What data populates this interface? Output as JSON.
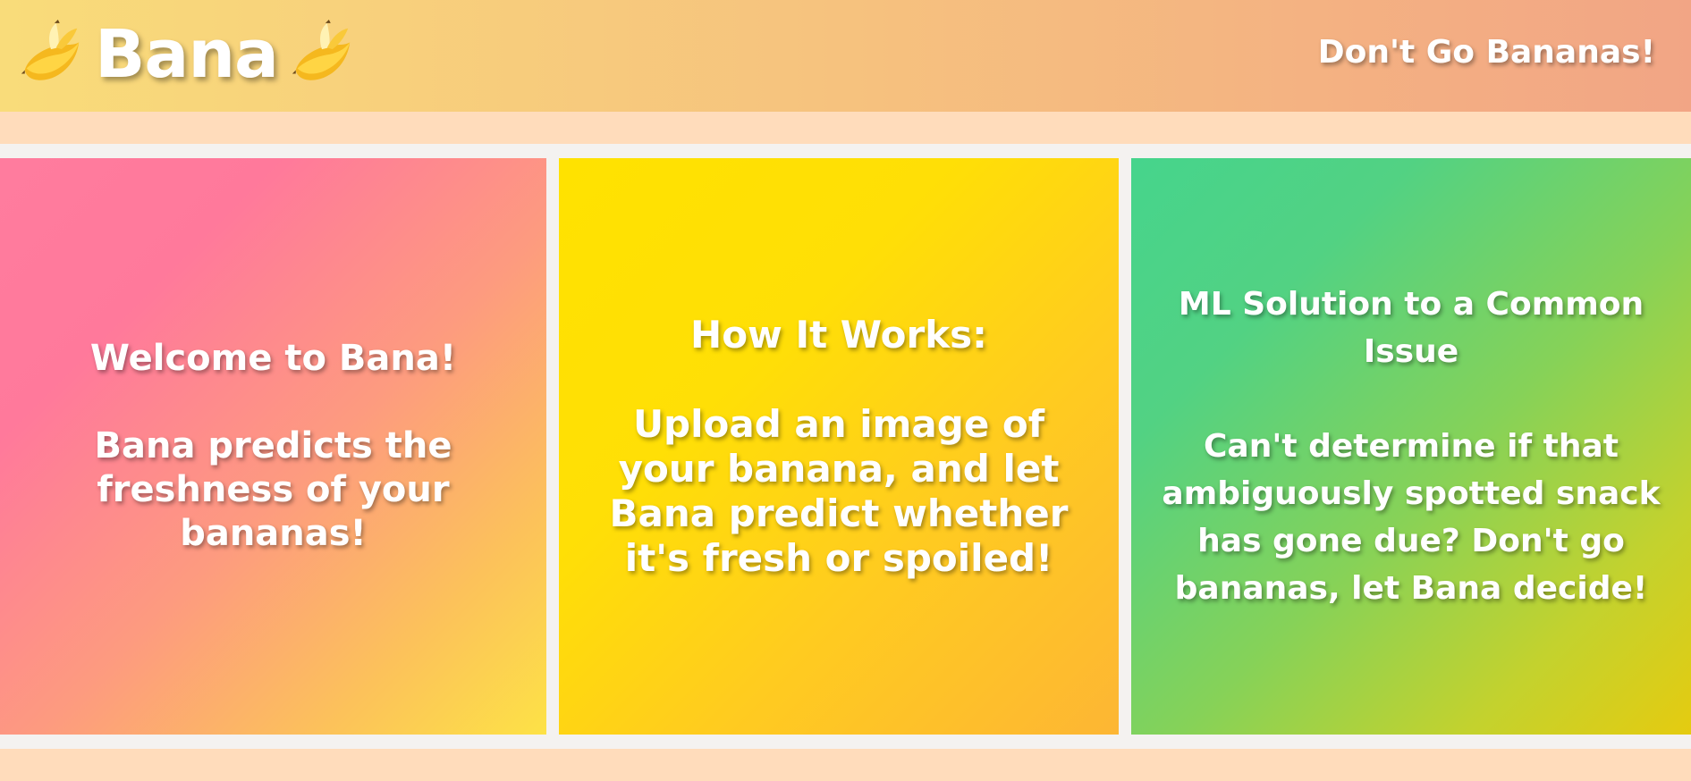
{
  "header": {
    "title": "Bana",
    "tagline": "Don't Go Bananas!",
    "logo_icon": "banana-icon"
  },
  "cards": [
    {
      "heading": "Welcome to Bana!",
      "body": "Bana predicts the freshness of your bananas!"
    },
    {
      "heading": "How It Works:",
      "body": "Upload an image of your banana, and let Bana predict whether it's fresh or spoiled!"
    },
    {
      "heading": "ML Solution to a Common Issue",
      "body": "Can't determine if that ambiguously spotted snack has gone due? Don't go bananas, let Bana decide!"
    }
  ],
  "colors": {
    "header_start": "#f9dc7a",
    "header_end": "#f2a585",
    "band": "#ffdcbb",
    "card_pink": "#ff7c9e",
    "card_yellow": "#ffe200",
    "card_green": "#46d48c"
  }
}
